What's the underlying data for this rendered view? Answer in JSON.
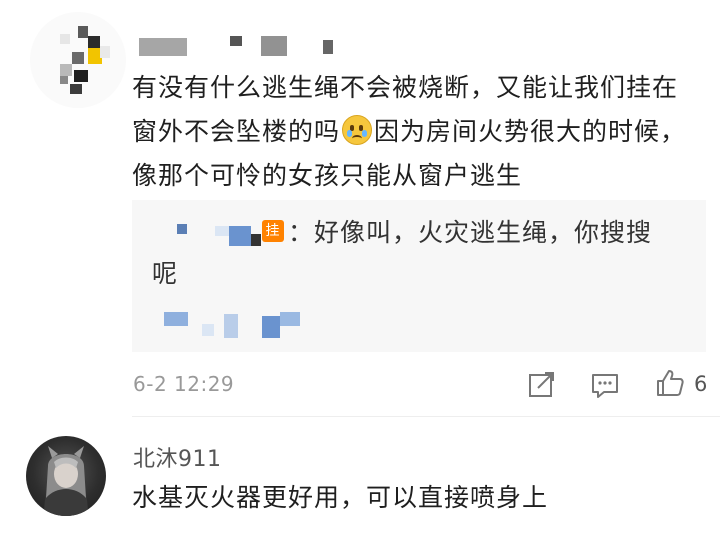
{
  "comments": [
    {
      "text_part1": "有没有什么逃生绳不会被烧断，又能让我们挂在窗外不会坠楼的吗",
      "emoji_icon": "pleading-face-icon",
      "text_part2": "因为房间火势很大的时候，像那个可怜的女孩只能从窗户逃生",
      "reply": {
        "badge": "挂",
        "text_line1": "：好像叫，火灾逃生绳，你搜搜",
        "text_line2": "呢"
      },
      "timestamp": "6-2 12:29",
      "like_count": "6"
    },
    {
      "username": "北沐911",
      "text": "水基灭火器更好用，可以直接喷身上"
    }
  ],
  "colors": {
    "badge": "#ff8200",
    "meta_text": "#999999",
    "reply_bg": "#f7f7f7"
  }
}
